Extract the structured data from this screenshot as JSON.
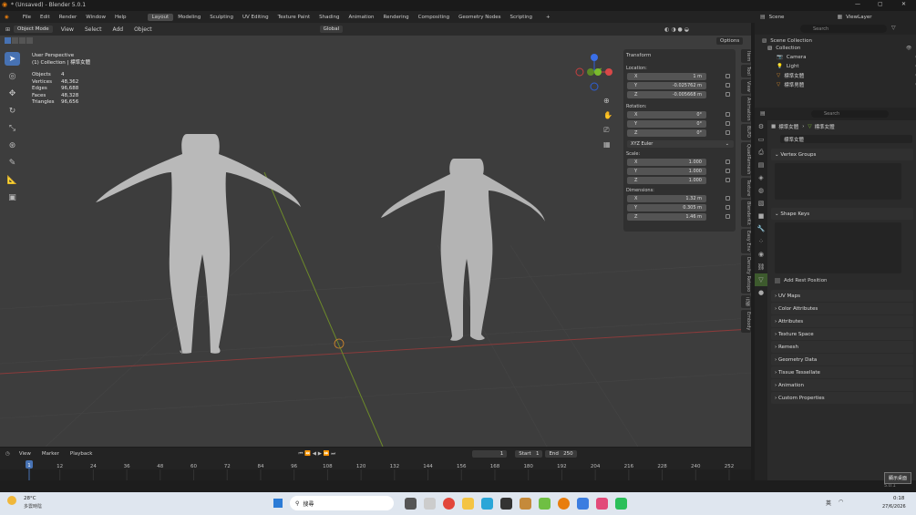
{
  "app": {
    "title": "* (Unsaved) - Blender 5.0.1"
  },
  "menu": {
    "items": [
      "File",
      "Edit",
      "Render",
      "Window",
      "Help"
    ],
    "workspaces": [
      "Layout",
      "Modeling",
      "Sculpting",
      "UV Editing",
      "Texture Paint",
      "Shading",
      "Animation",
      "Rendering",
      "Compositing",
      "Geometry Nodes",
      "Scripting"
    ],
    "active": "Layout"
  },
  "scene": {
    "label": "Scene",
    "viewlayer": "ViewLayer"
  },
  "viewport_header": {
    "mode": "Object Mode",
    "menus": [
      "View",
      "Select",
      "Add",
      "Object"
    ],
    "orientation": "Global",
    "options": "Options"
  },
  "overlay": {
    "perspective": "User Perspective",
    "collection": "(1) Collection | 標準女體",
    "stats": [
      {
        "k": "Objects",
        "v": "4"
      },
      {
        "k": "Vertices",
        "v": "48,362"
      },
      {
        "k": "Edges",
        "v": "96,688"
      },
      {
        "k": "Faces",
        "v": "48,328"
      },
      {
        "k": "Triangles",
        "v": "96,656"
      }
    ]
  },
  "transform": {
    "title": "Transform",
    "location_label": "Location:",
    "location": [
      {
        "a": "X",
        "v": "1 m"
      },
      {
        "a": "Y",
        "v": "-0.025762 m"
      },
      {
        "a": "Z",
        "v": "-0.005668 m"
      }
    ],
    "rotation_label": "Rotation:",
    "rotation": [
      {
        "a": "X",
        "v": "0°"
      },
      {
        "a": "Y",
        "v": "0°"
      },
      {
        "a": "Z",
        "v": "0°"
      }
    ],
    "rotation_mode": "XYZ Euler",
    "scale_label": "Scale:",
    "scale": [
      {
        "a": "X",
        "v": "1.000"
      },
      {
        "a": "Y",
        "v": "1.000"
      },
      {
        "a": "Z",
        "v": "1.000"
      }
    ],
    "dimensions_label": "Dimensions:",
    "dimensions": [
      {
        "a": "X",
        "v": "1.32 m"
      },
      {
        "a": "Y",
        "v": "0.305 m"
      },
      {
        "a": "Z",
        "v": "1.46 m"
      }
    ]
  },
  "side_tabs": [
    "Item",
    "Tool",
    "View",
    "Animation",
    "BLPD",
    "QuadRemesh",
    "Texture",
    "BlenderKit",
    "Easy Env",
    "Density Retopo",
    "元模",
    "Embody"
  ],
  "outliner": {
    "search": "Search",
    "root": "Scene Collection",
    "items": [
      {
        "name": "Collection"
      },
      {
        "name": "Camera"
      },
      {
        "name": "Light"
      },
      {
        "name": "標準女體"
      },
      {
        "name": "標準男體"
      }
    ]
  },
  "properties": {
    "search": "Search",
    "breadcrumb_obj": "標準女體",
    "breadcrumb_mesh": "標準女體",
    "mesh_name": "標準女體",
    "vertex_groups": "Vertex Groups",
    "shape_keys": "Shape Keys",
    "add_rest": "Add Rest Position",
    "sections": [
      "UV Maps",
      "Color Attributes",
      "Attributes",
      "Texture Space",
      "Remesh",
      "Geometry Data",
      "Tissue Tessellate",
      "Animation",
      "Custom Properties"
    ]
  },
  "timeline": {
    "menus": [
      "View",
      "Marker",
      "Playback"
    ],
    "frame": "1",
    "start_label": "Start",
    "start": "1",
    "end_label": "End",
    "end": "250",
    "ticks": [
      "12",
      "24",
      "36",
      "48",
      "60",
      "72",
      "84",
      "96",
      "108",
      "120",
      "132",
      "144",
      "156",
      "168",
      "180",
      "192",
      "204",
      "216",
      "228",
      "240",
      "252"
    ],
    "current": "1"
  },
  "statusbar": {
    "version": "5.0.1"
  },
  "taskbar": {
    "weather_temp": "28°C",
    "weather_desc": "多雲時陰",
    "search": "搜尋",
    "lang": "英",
    "time": "0:18",
    "date": "27/6/2026",
    "tooltip": "顯示桌面"
  },
  "colors": {
    "accent": "#4772b3",
    "viewport": "#3d3d3d",
    "x_axis": "#8a3b3b",
    "y_axis": "#6d8a2a"
  }
}
